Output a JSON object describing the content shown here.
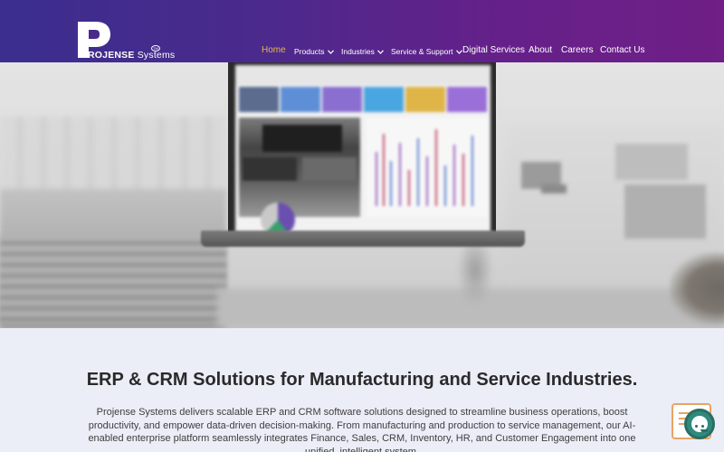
{
  "brand": {
    "name_bold": "ROJENSE",
    "name_light": " Systems",
    "tm": "TM",
    "logo_letter": "P"
  },
  "nav": {
    "items": [
      {
        "label": "Home",
        "active": true,
        "dropdown": false
      },
      {
        "label": "Products",
        "active": false,
        "dropdown": true
      },
      {
        "label": "Industries",
        "active": false,
        "dropdown": true
      },
      {
        "label": "Service & Support",
        "active": false,
        "dropdown": true
      },
      {
        "label": "Digital Services",
        "active": false,
        "dropdown": false
      },
      {
        "label": "About",
        "active": false,
        "dropdown": false
      },
      {
        "label": "Careers",
        "active": false,
        "dropdown": false
      },
      {
        "label": "Contact Us",
        "active": false,
        "dropdown": false
      }
    ]
  },
  "content": {
    "heading": "ERP & CRM Solutions for Manufacturing and Service Industries.",
    "description": "Projense Systems delivers scalable ERP and CRM software solutions designed to streamline business operations, boost productivity, and empower data-driven decision-making. From manufacturing and production to service management, our AI-enabled enterprise platform seamlessly integrates Finance, Sales, CRM, Inventory, HR, and Customer Engagement into one unified, intelligent system."
  },
  "colors": {
    "header_start": "#3b2e8e",
    "header_end": "#6f1f86",
    "active_nav": "#e3b84f",
    "content_bg": "#ebedf7",
    "chat_accent": "#2f8a7e"
  },
  "icons": {
    "dropdown": "chevron-down-icon",
    "chat": "chat-assistant-icon"
  }
}
